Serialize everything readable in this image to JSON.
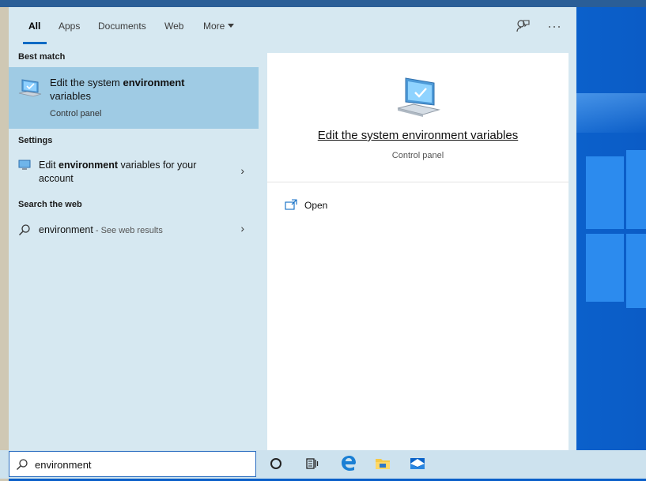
{
  "tabs": [
    {
      "label": "All",
      "active": true
    },
    {
      "label": "Apps"
    },
    {
      "label": "Documents"
    },
    {
      "label": "Web"
    },
    {
      "label": "More"
    }
  ],
  "header_icons": [
    "feedback-icon",
    "more-options-icon"
  ],
  "sections": {
    "best_match": "Best match",
    "settings": "Settings",
    "search_web": "Search the web"
  },
  "best_match": {
    "title_pre": "Edit the system ",
    "title_bold": "environment",
    "title_post": "variables",
    "subtitle": "Control panel",
    "icon": "monitor-checkmark-icon"
  },
  "settings_item": {
    "pre": "Edit ",
    "bold": "environment",
    "post": " variables for your",
    "line2": "account",
    "icon": "display-settings-icon"
  },
  "web_item": {
    "bold": "environment",
    "suffix": " - See web results",
    "icon": "search-icon"
  },
  "preview": {
    "title": "Edit the system environment variables",
    "subtitle": "Control panel",
    "open_label": "Open",
    "icon": "monitor-checkmark-icon"
  },
  "search": {
    "value": "environment"
  },
  "taskbar_icons": [
    "cortana-icon",
    "task-view-icon",
    "edge-icon",
    "file-explorer-icon",
    "mail-icon"
  ],
  "colors": {
    "accent": "#0b6ac4",
    "selected_bg": "#9fcbe4",
    "panel_bg": "#d6e8f1"
  }
}
